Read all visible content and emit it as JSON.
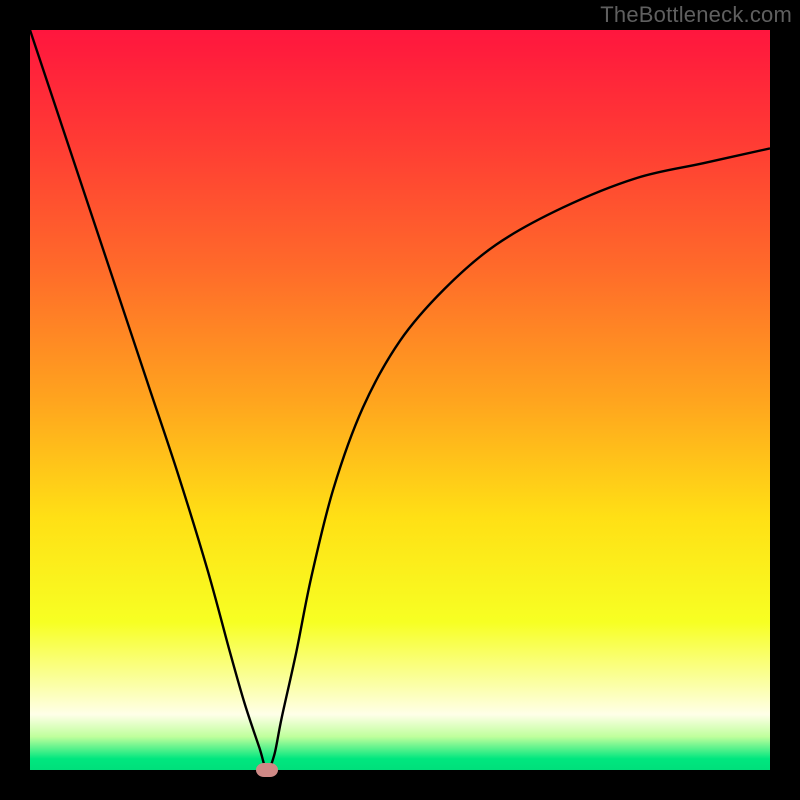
{
  "attribution": "TheBottleneck.com",
  "chart_data": {
    "type": "line",
    "title": "",
    "xlabel": "",
    "ylabel": "",
    "xlim": [
      0,
      100
    ],
    "ylim": [
      0,
      100
    ],
    "grid": false,
    "legend": false,
    "background_gradient_stops": [
      {
        "offset": 0.0,
        "color": "#ff163e"
      },
      {
        "offset": 0.15,
        "color": "#ff3b34"
      },
      {
        "offset": 0.32,
        "color": "#ff6a2a"
      },
      {
        "offset": 0.5,
        "color": "#ffa41e"
      },
      {
        "offset": 0.66,
        "color": "#ffe015"
      },
      {
        "offset": 0.8,
        "color": "#f7ff23"
      },
      {
        "offset": 0.885,
        "color": "#fbffa7"
      },
      {
        "offset": 0.925,
        "color": "#ffffe8"
      },
      {
        "offset": 0.955,
        "color": "#bfff9c"
      },
      {
        "offset": 0.985,
        "color": "#00e77f"
      },
      {
        "offset": 1.0,
        "color": "#00df7b"
      }
    ],
    "series": [
      {
        "name": "bottleneck-curve",
        "stroke": "#000000",
        "x": [
          0,
          4,
          8,
          12,
          16,
          20,
          24,
          27,
          29,
          31,
          32,
          33,
          34,
          36,
          38,
          41,
          45,
          50,
          56,
          63,
          72,
          82,
          91,
          100
        ],
        "y": [
          100,
          88,
          76,
          64,
          52,
          40,
          27,
          16,
          9,
          3,
          0,
          2,
          7,
          16,
          26,
          38,
          49,
          58,
          65,
          71,
          76,
          80,
          82,
          84
        ]
      }
    ],
    "marker": {
      "x": 32,
      "y": 0,
      "color": "#cf8986"
    }
  }
}
